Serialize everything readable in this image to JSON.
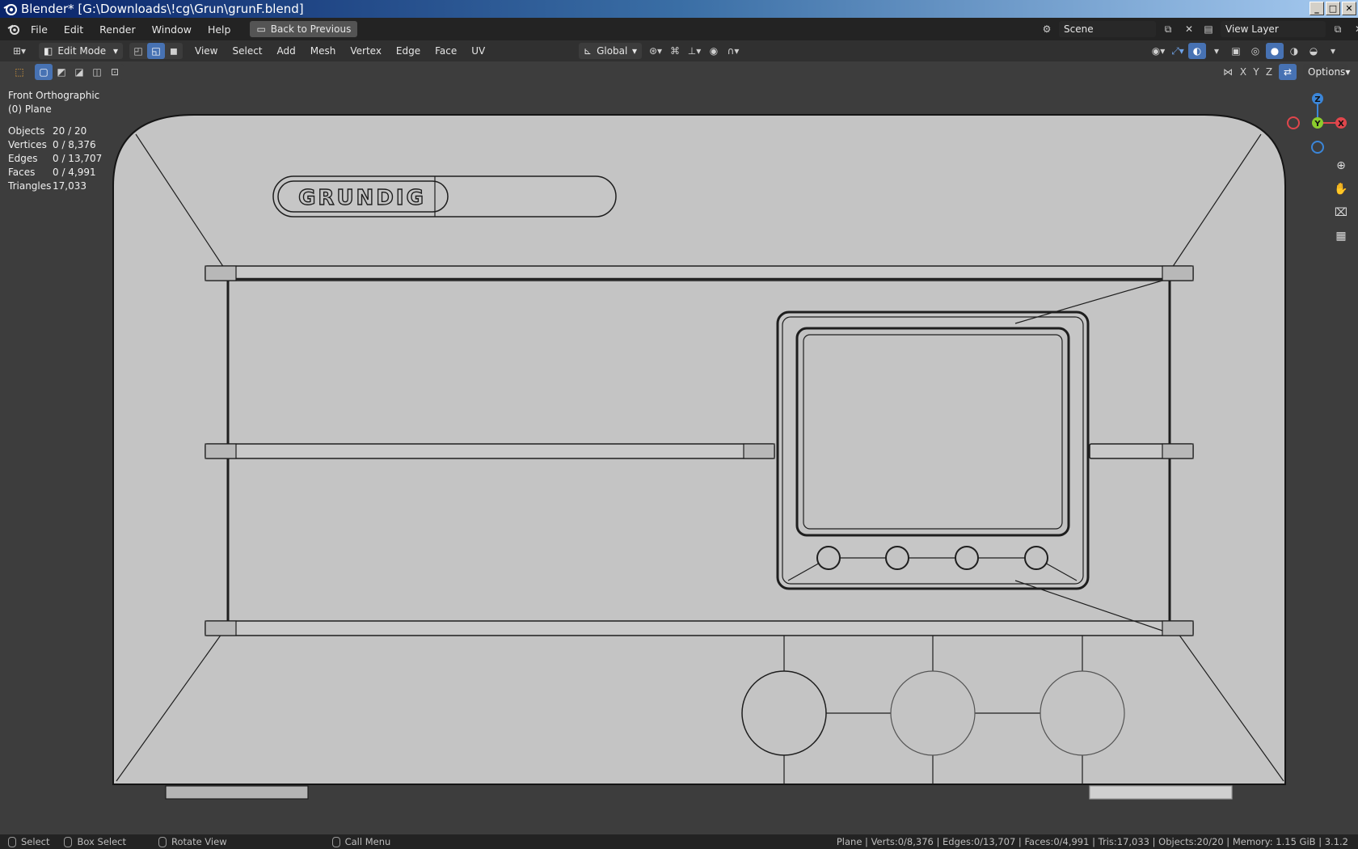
{
  "window": {
    "title": "Blender* [G:\\Downloads\\!cg\\Grun\\grunF.blend]",
    "buttons": [
      "_",
      "□",
      "✕"
    ]
  },
  "topbar": {
    "menus": [
      "File",
      "Edit",
      "Render",
      "Window",
      "Help"
    ],
    "back_button": "Back to Previous",
    "scene": "Scene",
    "view_layer": "View Layer"
  },
  "header": {
    "mode": "Edit Mode",
    "menus": [
      "View",
      "Select",
      "Add",
      "Mesh",
      "Vertex",
      "Edge",
      "Face",
      "UV"
    ],
    "orientation": "Global",
    "options": "Options",
    "axes": [
      "X",
      "Y",
      "Z"
    ]
  },
  "overlay": {
    "view_name": "Front Orthographic",
    "object_name": "(0) Plane",
    "stats": [
      {
        "label": "Objects",
        "value": "20 / 20"
      },
      {
        "label": "Vertices",
        "value": "0 / 8,376"
      },
      {
        "label": "Edges",
        "value": "0 / 13,707"
      },
      {
        "label": "Faces",
        "value": "0 / 4,991"
      },
      {
        "label": "Triangles",
        "value": "17,033"
      }
    ]
  },
  "model": {
    "logo_text": "GRUNDIG"
  },
  "gizmo": {
    "x": "X",
    "y": "Y",
    "z": "Z",
    "colors": {
      "x": "#e0464c",
      "y": "#8bcc2d",
      "z": "#3b86d9"
    }
  },
  "statusbar": {
    "hints": [
      "Select",
      "Box Select",
      "Rotate View",
      "Call Menu"
    ],
    "info": "Plane | Verts:0/8,376 | Edges:0/13,707 | Faces:0/4,991 | Tris:17,033 | Objects:20/20 | Memory: 1.15 GiB | 3.1.2"
  },
  "colors": {
    "accent": "#4772b3",
    "viewport_bg": "#3d3d3d",
    "model_fill": "#c4c4c4"
  }
}
